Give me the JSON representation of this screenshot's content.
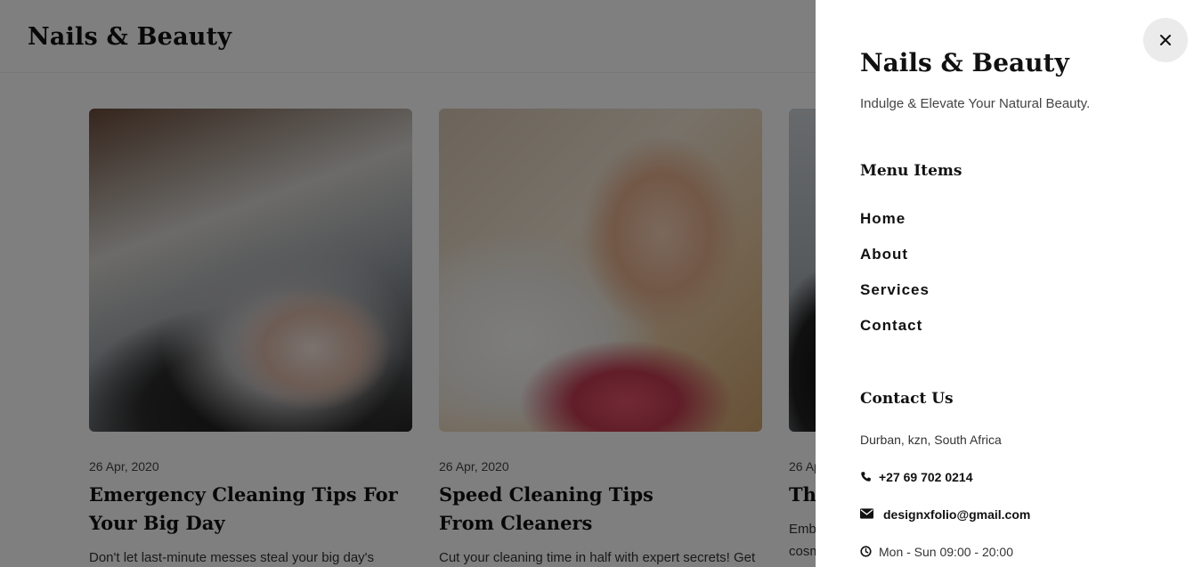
{
  "site": {
    "logo": "Nails & Beauty"
  },
  "posts": [
    {
      "date": "26 Apr, 2020",
      "title": "Emergency Cleaning Tips For Your Big Day",
      "excerpt": "Don't let last-minute messes steal your big day's shine!"
    },
    {
      "date": "26 Apr, 2020",
      "title": "Speed Cleaning Tips From Cleaners",
      "excerpt": "Cut your cleaning time in half with expert secrets! Get"
    },
    {
      "date": "26 Ap",
      "title": "The",
      "excerpt": "Emb cosm"
    }
  ],
  "panel": {
    "brand": "Nails & Beauty",
    "tagline": "Indulge & Elevate Your Natural Beauty.",
    "menu_heading": "Menu Items",
    "menu": [
      "Home",
      "About",
      "Services",
      "Contact"
    ],
    "contact_heading": "Contact Us",
    "address": "Durban, kzn, South Africa",
    "phone": "+27 69 702 0214",
    "email": "designxfolio@gmail.com",
    "hours": "Mon - Sun 09:00 - 20:00"
  },
  "icons": {
    "close": "close-icon",
    "phone": "phone-icon",
    "email": "envelope-icon",
    "hours": "clock-icon"
  },
  "colors": {
    "overlay": "#000000",
    "panel_bg": "#ffffff",
    "close_bg": "#ebebeb",
    "text": "#111111"
  }
}
